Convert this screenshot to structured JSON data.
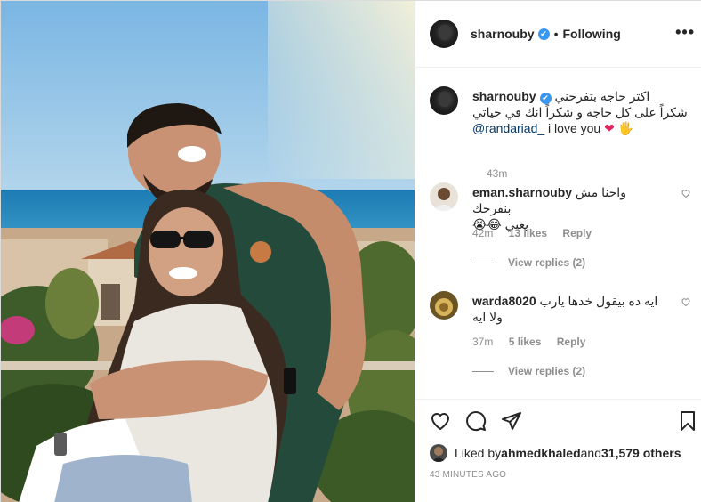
{
  "header": {
    "username": "sharnouby",
    "verified_mark": "✔",
    "separator": "•",
    "follow_status": "Following",
    "more_label": "•••"
  },
  "caption": {
    "username": "sharnouby",
    "line1": "اكتر حاجه بتفرحني",
    "line2": "شكراً على كل حاجه و شكراً انك في حياتي",
    "mention": "@randariad_",
    "text_after_mention": " i love you ",
    "emoji_heart": "❤",
    "emoji_hand": "🖐",
    "time": "43m"
  },
  "comments": [
    {
      "username": "eman.sharnouby",
      "text_line1": "واحنا مش بنفرحك",
      "text_line2": "يعني 😂😭",
      "time": "42m",
      "likes": "13 likes",
      "reply": "Reply",
      "view_replies": "View replies (2)"
    },
    {
      "username": "warda8020",
      "text_line1": "ايه ده بيقول خدها يارب",
      "text_line2": "ولا ايه",
      "time": "37m",
      "likes": "5 likes",
      "reply": "Reply",
      "view_replies": "View replies (2)"
    }
  ],
  "actions": {
    "liked_by_prefix": "Liked by ",
    "liked_by_user": "ahmedkhaled",
    "liked_by_and": " and ",
    "liked_by_count": "31,579 others",
    "post_time": "43 MINUTES AGO"
  },
  "icons": [
    "heart-icon",
    "comment-icon",
    "share-icon",
    "bookmark-icon",
    "more-icon"
  ],
  "colors": {
    "verified": "#3897f0",
    "mention": "#00376b",
    "muted": "#8e8e8e",
    "heart": "#e0245e"
  }
}
